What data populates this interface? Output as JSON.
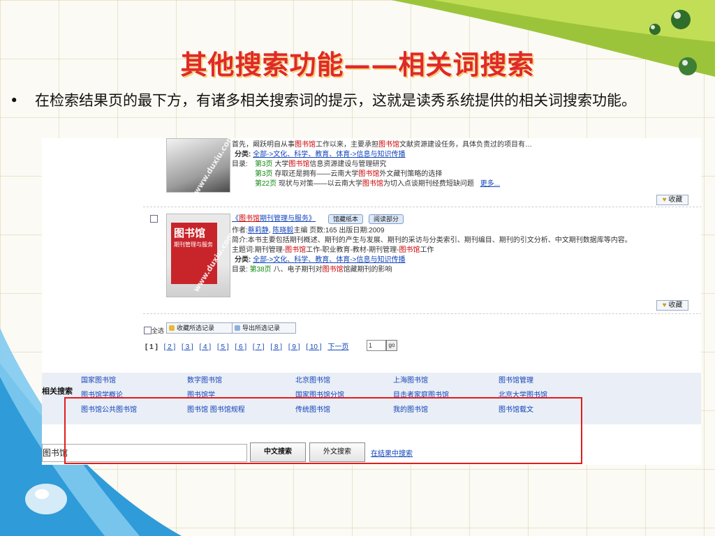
{
  "slide": {
    "title": "其他搜索功能——相关词搜索",
    "bullet_symbol": "•",
    "bullet_text": "在检索结果页的最下方，有诸多相关搜索词的提示，这就是读秀系统提供的相关词搜索功能。"
  },
  "result1": {
    "intro_a": "首先，阚跃明自从事",
    "intro_hl": "图书馆",
    "intro_b": "工作以来，主要承担",
    "intro_hl2": "图书馆",
    "intro_c": "文献资源建设任务，具体负责过的项目有…",
    "category_label": "分类:",
    "category_path": "全部->文化、科学、教育、体育->信息与知识传播",
    "toc_label": "目录:",
    "toc": [
      {
        "page": "第3页",
        "a": " 大学",
        "hl": "图书馆",
        "b": "信息资源建设与管理研究"
      },
      {
        "page": "第3页",
        "a": " 存取还是拥有——云南大学",
        "hl": "图书馆",
        "b": "外文藏刊策略的选择"
      },
      {
        "page": "第22页",
        "a": " 现状与对策——以云南大学",
        "hl": "图书馆",
        "b": "为切入点谈期刊经费短缺问题"
      }
    ],
    "more": "更多...",
    "favorite": "收藏"
  },
  "result2": {
    "title_open": "《",
    "title_hl": "图书馆",
    "title_rest": "期刊管理与服务》",
    "btn_paper": "馆藏纸本",
    "btn_read": "阅读部分",
    "author_label": "作者:",
    "author1": "蔡莉静",
    "author2": "陈晓毅",
    "author_tail": "主编  页数:165  出版日期:2009",
    "summary": "简介:本书主要包括期刊概述、期刊的产生与发展、期刊的采访与分类索引、期刊编目、期刊的引文分析、中文期刊数据库等内容。",
    "subject_a": "主题词:期刊管理-",
    "subject_hl": "图书馆",
    "subject_b": "工作-职业教育-教材-期刊管理-",
    "subject_hl2": "图书馆",
    "subject_c": "工作",
    "category_label": "分类:",
    "category_path": "全部->文化、科学、教育、体育->信息与知识传播",
    "toc_label": "目录:",
    "toc_page": "第38页",
    "toc_a": " 八、电子期刊对",
    "toc_hl": "图书馆",
    "toc_b": "馆藏期刊的影响",
    "cover_title": "图书馆",
    "cover_sub": "期刊管理与服务",
    "favorite": "收藏"
  },
  "toolbar": {
    "select_all": "全选",
    "collect_selected": "收藏所选记录",
    "export_selected": "导出所选记录"
  },
  "pager": {
    "current": "[ 1 ]",
    "pages": [
      "[ 2 ]",
      "[ 3 ]",
      "[ 4 ]",
      "[ 5 ]",
      "[ 6 ]",
      "[ 7 ]",
      "[ 8 ]",
      "[ 9 ]",
      "[ 10 ]"
    ],
    "next": "下一页",
    "page_value": "1",
    "go": "go"
  },
  "related": {
    "label": "相关搜索",
    "rows": [
      [
        "国家图书馆",
        "数字图书馆",
        "北京图书馆",
        "上海图书馆",
        "图书馆管理"
      ],
      [
        "图书馆学概论",
        "图书馆学",
        "国家图书馆分馆",
        "目击者家庭图书馆",
        "北京大学图书馆"
      ],
      [
        "图书馆公共图书馆",
        "图书馆 图书馆规程",
        "传统图书馆",
        "我的图书馆",
        "图书馆载文"
      ]
    ]
  },
  "search": {
    "query": "图书馆",
    "chinese_search": "中文搜索",
    "foreign_search": "外文搜索",
    "search_in_results": "在结果中搜索"
  },
  "watermark": "www.duxiu.com",
  "colors": {
    "title": "#e0292b",
    "link": "#1144bb",
    "highlight": "#cc0000",
    "page_num": "#118811",
    "highlight_box": "#e21c1c"
  }
}
